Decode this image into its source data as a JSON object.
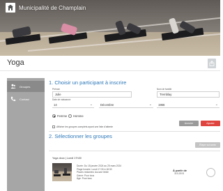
{
  "header": {
    "municipality": "Municipalité de Champlain",
    "logo_icon": "building-icon"
  },
  "page": {
    "title": "Yoga",
    "share_icon": "share-icon"
  },
  "sidebar": {
    "items": [
      {
        "label": "Groupes",
        "icon": "users-icon",
        "active": true
      },
      {
        "label": "Contact",
        "icon": "phone-icon",
        "active": false
      }
    ]
  },
  "step1": {
    "title": "1. Choisir un participant à inscrire",
    "first_name_label": "Prénom",
    "first_name_value": "Julie",
    "last_name_label": "Nom de famille",
    "last_name_value": "Tremblay",
    "birth_label": "Date de naissance",
    "birth_day": "14",
    "birth_month": "Décembre",
    "birth_year": "1966",
    "gender_female": "Femme",
    "gender_male": "Homme",
    "gender_selected": "female",
    "show_full_groups_label": "Afficher les groupes complets ayant une liste d'attente",
    "cancel_button": "Annuler",
    "add_button": "Ajouter"
  },
  "step2": {
    "title": "2. Sélectionner les groupes",
    "tag_button": "Étape suivante"
  },
  "activity": {
    "header": "Yoga doux | Lundi 17h30",
    "lines": [
      "Durée: Du 15 janvier 2024 au 25 mars 2024",
      "Plage horaire: Lundi 17:30 à 18:30",
      "Places restantes: Aucune limite",
      "Genre: Pour tous",
      "Âge: Pour tous"
    ],
    "price_label": "À partir de",
    "price": "110,00 $"
  },
  "colors": {
    "accent": "#2c77b8",
    "danger": "#e0443e",
    "sidebar": "#a6a6a6",
    "sidebar_active": "#8a8a8a"
  }
}
